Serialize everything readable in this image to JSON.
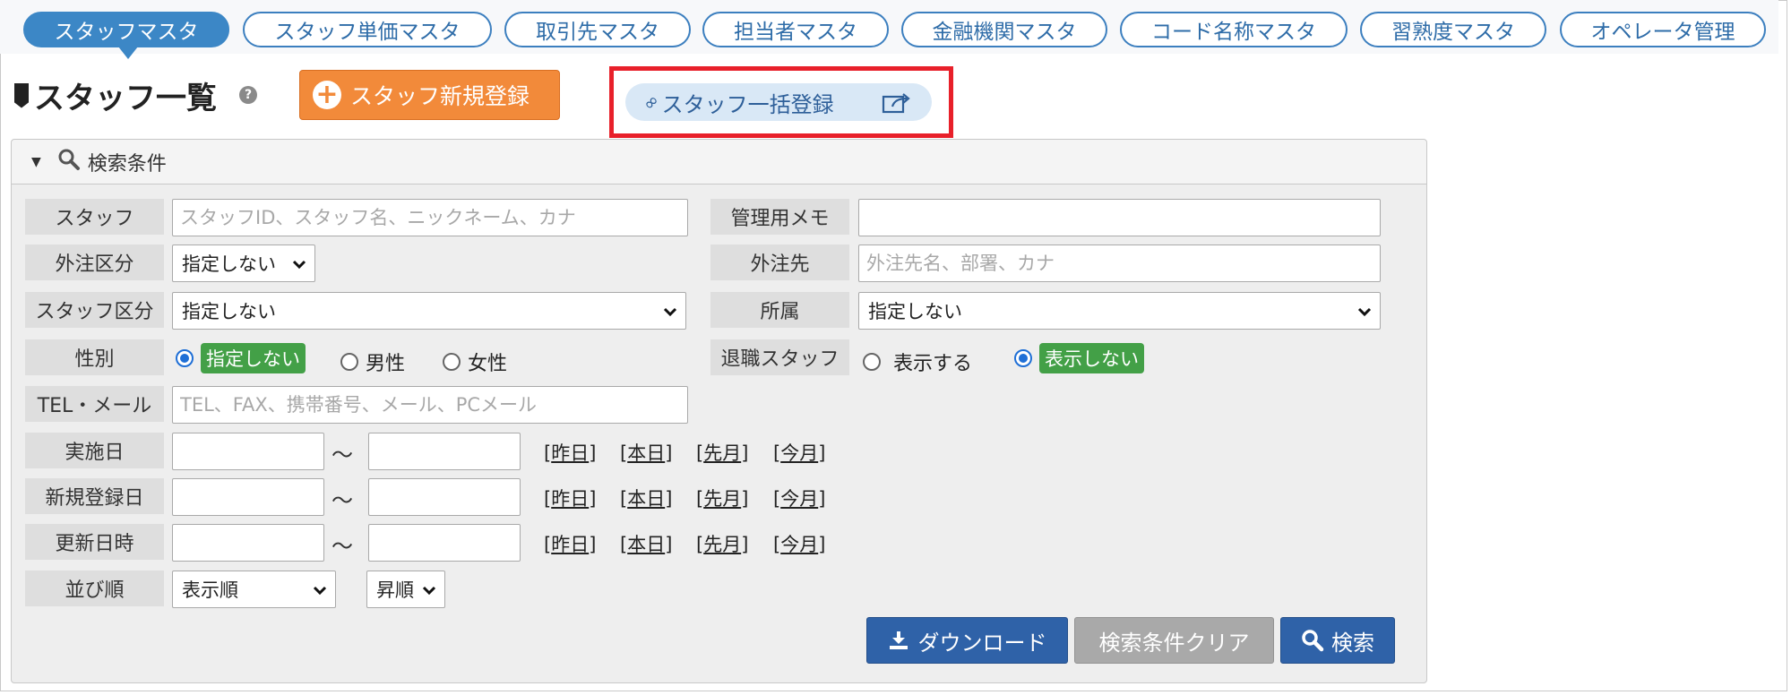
{
  "tabs": [
    {
      "label": "スタッフマスタ",
      "active": true
    },
    {
      "label": "スタッフ単価マスタ",
      "active": false
    },
    {
      "label": "取引先マスタ",
      "active": false
    },
    {
      "label": "担当者マスタ",
      "active": false
    },
    {
      "label": "金融機関マスタ",
      "active": false
    },
    {
      "label": "コード名称マスタ",
      "active": false
    },
    {
      "label": "習熟度マスタ",
      "active": false
    },
    {
      "label": "オペレータ管理",
      "active": false
    }
  ],
  "header": {
    "title": "スタッフ一覧",
    "help_icon": "?",
    "new_button_label": "スタッフ新規登録",
    "bulk_button_label": "スタッフ一括登録"
  },
  "search": {
    "panel_title": "検索条件",
    "staff": {
      "label": "スタッフ",
      "placeholder": "スタッフID、スタッフ名、ニックネーム、カナ",
      "value": ""
    },
    "memo": {
      "label": "管理用メモ",
      "value": ""
    },
    "outsource_type": {
      "label": "外注区分",
      "selected": "指定しない"
    },
    "outsource_to": {
      "label": "外注先",
      "placeholder": "外注先名、部署、カナ",
      "value": ""
    },
    "staff_type": {
      "label": "スタッフ区分",
      "selected": "指定しない"
    },
    "affiliation": {
      "label": "所属",
      "selected": "指定しない"
    },
    "gender": {
      "label": "性別",
      "options": [
        "指定しない",
        "男性",
        "女性"
      ],
      "selected": "指定しない"
    },
    "retired": {
      "label": "退職スタッフ",
      "options": [
        "表示する",
        "表示しない"
      ],
      "selected": "表示しない"
    },
    "contact": {
      "label": "TEL・メール",
      "placeholder": "TEL、FAX、携帯番号、メール、PCメール",
      "value": ""
    },
    "date_rows": [
      {
        "label": "実施日"
      },
      {
        "label": "新規登録日"
      },
      {
        "label": "更新日時"
      }
    ],
    "range_separator": "～",
    "quick_links": [
      "昨日",
      "本日",
      "先月",
      "今月"
    ],
    "sort": {
      "label": "並び順",
      "selected": "表示順",
      "order": "昇順"
    }
  },
  "buttons": {
    "download": "ダウンロード",
    "clear": "検索条件クリア",
    "search": "検索"
  },
  "colors": {
    "tab_active": "#3c87c6",
    "new_button": "#f28a3a",
    "highlight": "#e8202a",
    "badge_green": "#43a047",
    "button_blue": "#2f62a8"
  }
}
